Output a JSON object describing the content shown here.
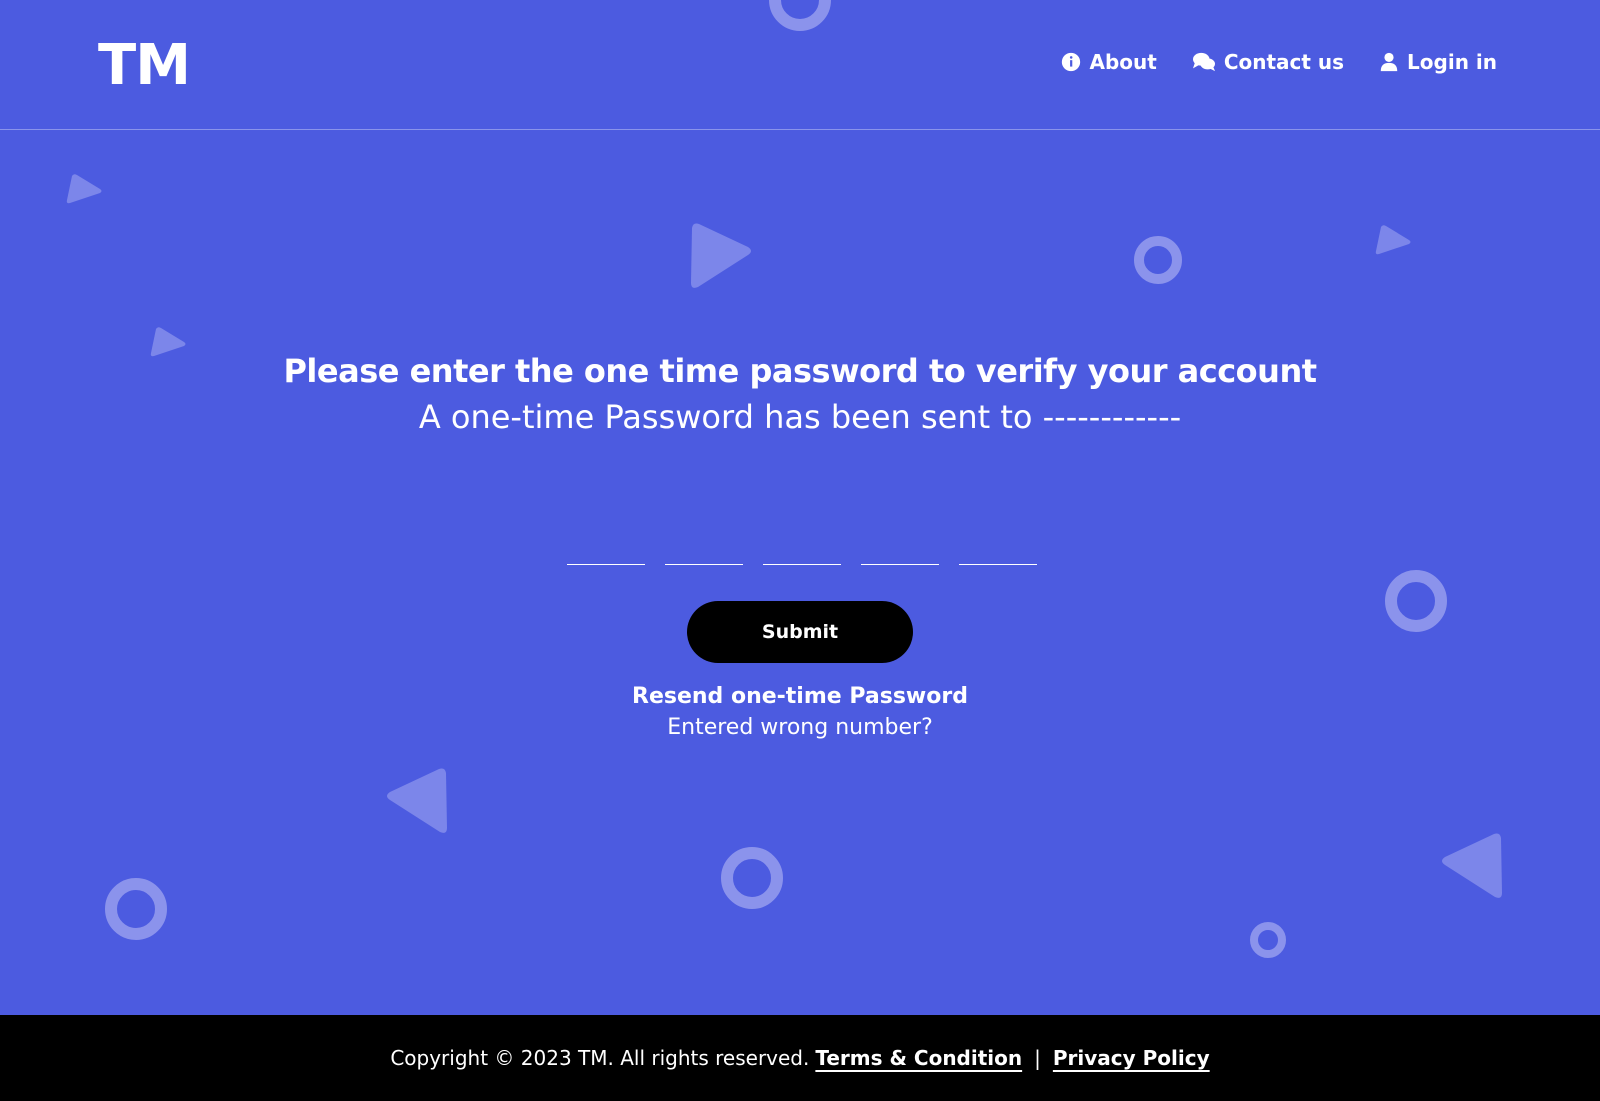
{
  "header": {
    "logo": "TM",
    "nav": [
      {
        "label": "About",
        "icon": "info-icon"
      },
      {
        "label": "Contact us",
        "icon": "chat-icon"
      },
      {
        "label": "Login in",
        "icon": "user-icon"
      }
    ]
  },
  "main": {
    "title": "Please enter the one time password to verify your account",
    "subtitle": "A one-time Password has been sent to ------------",
    "otp_placeholders": [
      "",
      "",
      "",
      "",
      ""
    ],
    "submit_label": "Submit",
    "resend_label": "Resend one-time Password",
    "wrong_number_label": "Entered wrong number?"
  },
  "footer": {
    "copyright": "Copyright ©  2023 TM. All rights reserved.",
    "terms_label": "Terms & Condition",
    "separator": "|",
    "privacy_label": "Privacy Policy"
  },
  "colors": {
    "background": "#4C5BE0",
    "footer": "#000000",
    "accent_shape": "#8B93EC"
  }
}
